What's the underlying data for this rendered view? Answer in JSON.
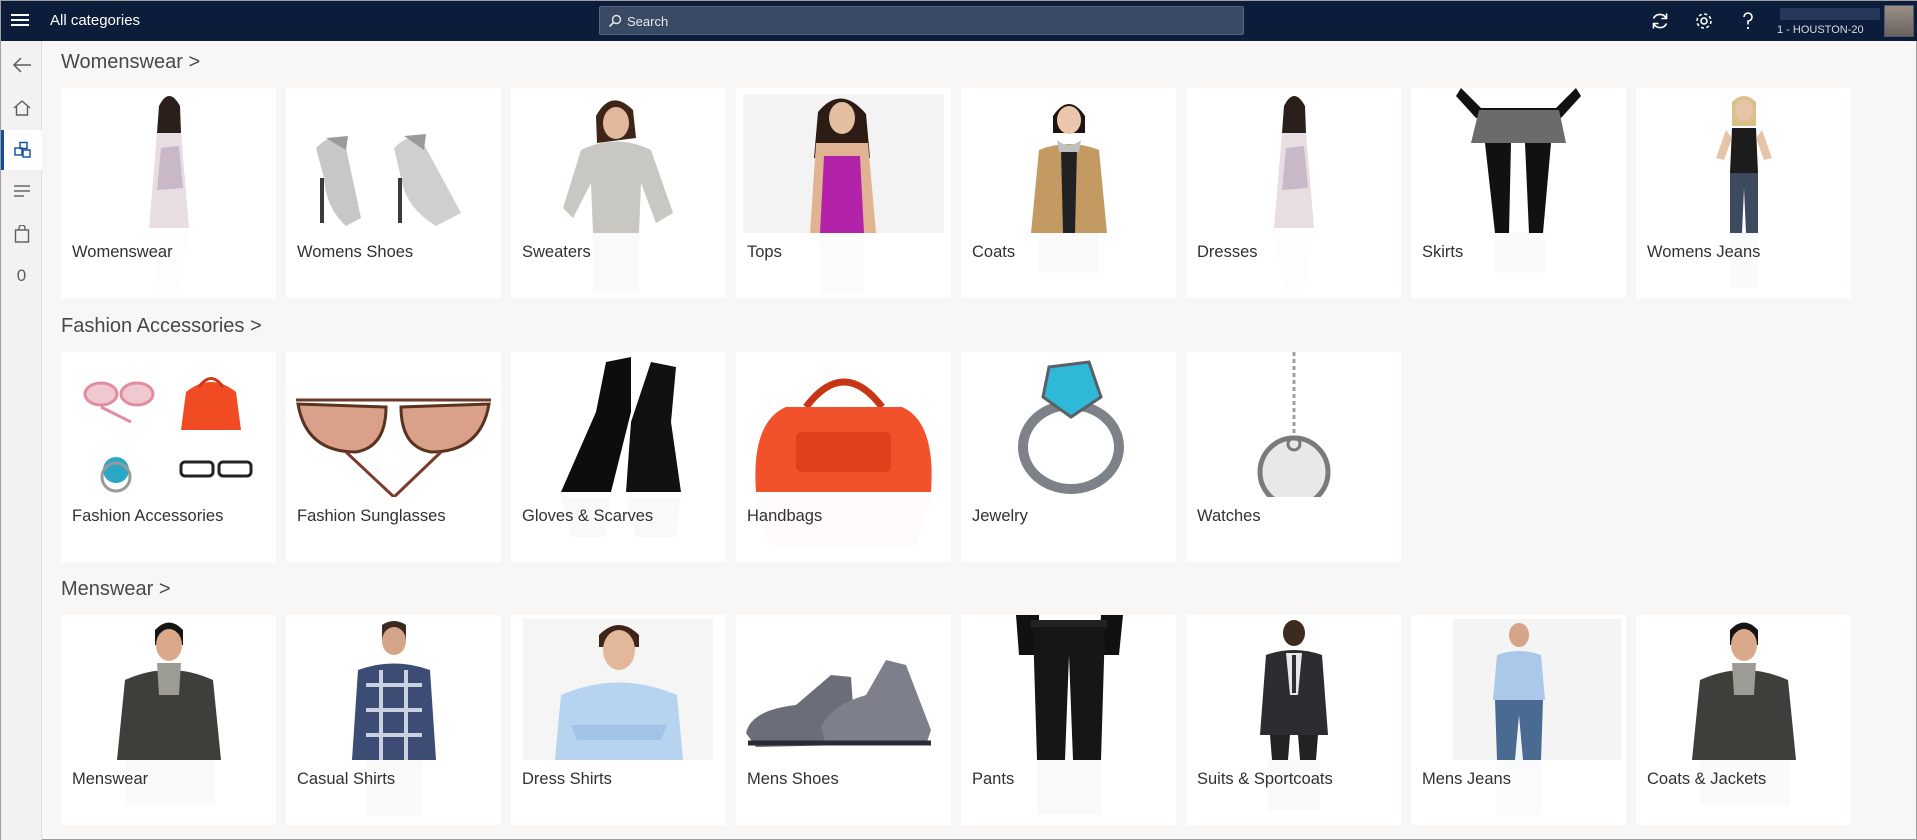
{
  "header": {
    "title": "All categories",
    "search_placeholder": "Search",
    "store_label": "1 - HOUSTON-20"
  },
  "rail": {
    "cart_count": "0"
  },
  "sections": [
    {
      "title": "Womenswear >",
      "tiles": [
        "Womenswear",
        "Womens Shoes",
        "Sweaters",
        "Tops",
        "Coats",
        "Dresses",
        "Skirts",
        "Womens Jeans"
      ]
    },
    {
      "title": "Fashion Accessories >",
      "tiles": [
        "Fashion Accessories",
        "Fashion Sunglasses",
        "Gloves & Scarves",
        "Handbags",
        "Jewelry",
        "Watches"
      ]
    },
    {
      "title": "Menswear >",
      "tiles": [
        "Menswear",
        "Casual Shirts",
        "Dress Shirts",
        "Mens Shoes",
        "Pants",
        "Suits & Sportcoats",
        "Mens Jeans",
        "Coats & Jackets"
      ]
    }
  ],
  "colors": {
    "topbar": "#0b1d3a",
    "accent": "#0f4c9a",
    "background": "#f8f7f6"
  }
}
